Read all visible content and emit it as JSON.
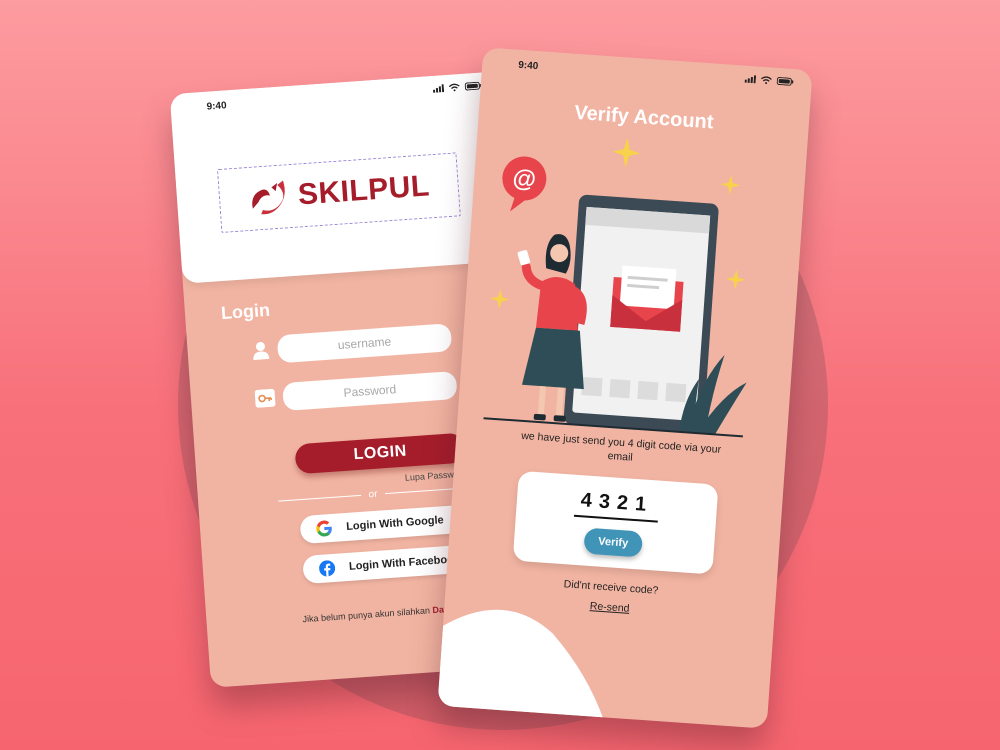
{
  "login_screen": {
    "status_time": "9:40",
    "brand_name": "SKILPUL",
    "title": "Login",
    "username_placeholder": "username",
    "password_placeholder": "Password",
    "login_label": "LOGIN",
    "forgot_password": "Lupa Password",
    "divider_text": "or",
    "google_label": "Login With Google",
    "facebook_label": "Login With Facebook",
    "signup_prompt": "Jika belum punya akun silahkan",
    "signup_link": "Daftar"
  },
  "verify_screen": {
    "status_time": "9:40",
    "title": "Verify Account",
    "instruction": "we have just send you 4 digit code via your email",
    "code": "4321",
    "verify_label": "Verify",
    "resend_prompt": "Did'nt receive code?",
    "resend_link": "Re-send"
  },
  "icons": [
    "user-icon",
    "key-icon",
    "google-icon",
    "facebook-icon",
    "signal-icon",
    "wifi-icon",
    "battery-icon",
    "at-sign-icon",
    "envelope-icon",
    "sparkle-icon"
  ],
  "colors": {
    "brand_red": "#a51d2b",
    "phone_bg": "#f2b4a2",
    "verify_blue": "#3f94b8",
    "background": "#f8707a"
  }
}
